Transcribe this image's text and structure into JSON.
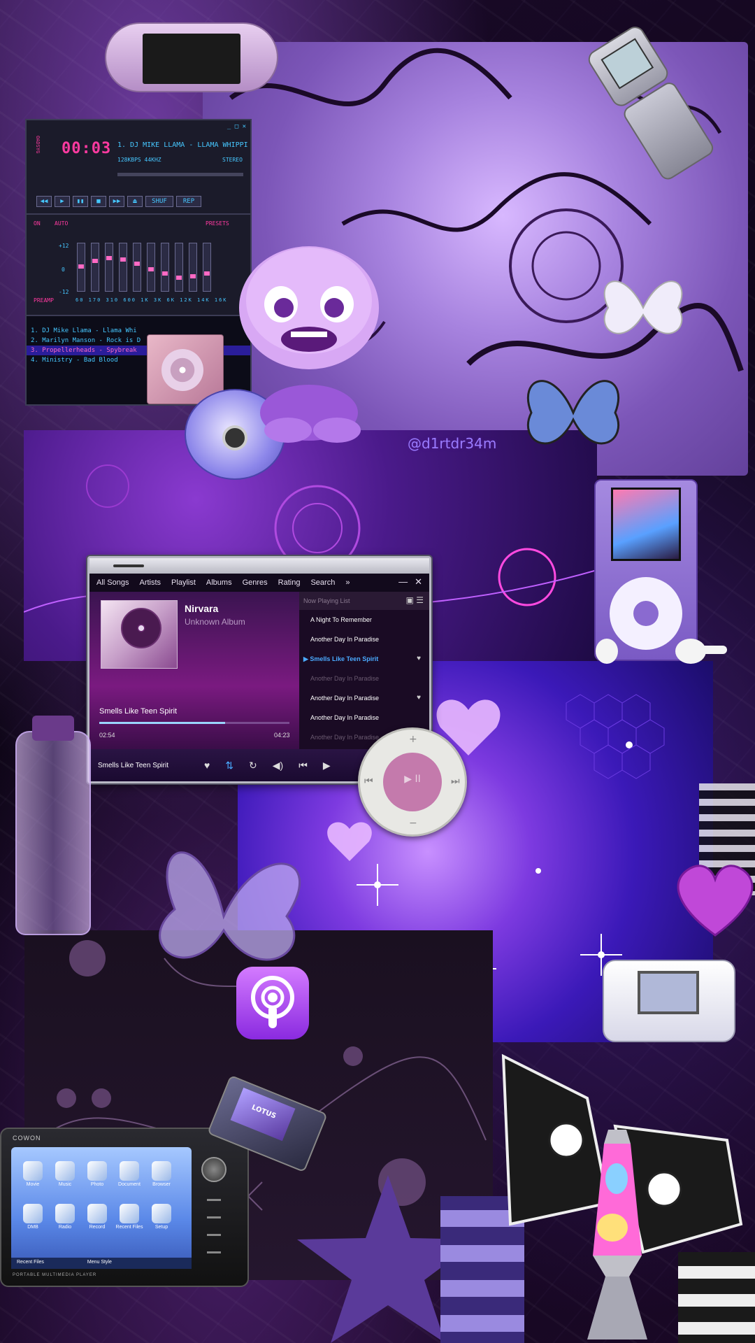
{
  "watermark": "@d1rtdr34m",
  "winamp": {
    "time": "00:03",
    "title": "1. DJ MIKE LLAMA - LLAMA WHIPPI",
    "bitrate": "128KBPS  44KHZ",
    "mode": "STEREO",
    "side_label": "OADSYG",
    "buttons": [
      "◀◀",
      "▶",
      "▮▮",
      "■",
      "▶▶",
      "⏏"
    ],
    "shuf": "SHUF",
    "rep": "REP",
    "eq_on": "ON",
    "eq_auto": "AUTO",
    "eq_presets": "PRESETS",
    "eq_preamp": "PREAMP",
    "eq_freqs": "60 170 310 600 1K 3K 6K 12K 14K 16K",
    "eq_levels": [
      "+12",
      "0",
      "-12"
    ],
    "playlist": [
      "1. DJ Mike Llama - Llama Whi",
      "2. Marilyn Manson - Rock is D",
      "3. Propellerheads - Spybreak",
      "4. Ministry - Bad Blood"
    ]
  },
  "media_player": {
    "nav": [
      "All Songs",
      "Artists",
      "Playlist",
      "Albums",
      "Genres",
      "Rating",
      "Search",
      "»"
    ],
    "minimize": "—",
    "close": "✕",
    "artist": "Nirvara",
    "album": "Unknown Album",
    "song": "Smells Like Teen Spirit",
    "elapsed": "02:54",
    "total": "04:23",
    "progress": 0.66,
    "list_header": "Now Playing List",
    "list": [
      {
        "title": "A Night To Remember",
        "style": "normal",
        "heart": ""
      },
      {
        "title": "Another Day In Paradise",
        "style": "normal",
        "heart": ""
      },
      {
        "title": "Smells Like Teen Spirit",
        "style": "cur",
        "heart": "♥"
      },
      {
        "title": "Another Day In Paradise",
        "style": "dim",
        "heart": ""
      },
      {
        "title": "Another Day In Paradise",
        "style": "normal",
        "heart": "♥"
      },
      {
        "title": "Another Day In Paradise",
        "style": "normal",
        "heart": ""
      },
      {
        "title": "Another Day In Paradise",
        "style": "dim",
        "heart": ""
      }
    ],
    "bottom_song": "Smells Like Teen Spirit",
    "controls": {
      "heart": "♥",
      "shuffle": "⇅",
      "repeat": "↻",
      "volume": "◀)",
      "prev": "⏮",
      "play": "▶"
    }
  },
  "shuffle": {
    "play_pause": "▶ II",
    "plus": "+",
    "minus": "−",
    "prev": "⏮",
    "next": "⏭"
  },
  "lg_phone": {
    "screen": "LOTUS"
  },
  "cowon": {
    "brand": "COWON",
    "subtitle": "PORTABLE MULTIMEDIA PLAYER",
    "apps": [
      "Movie",
      "Music",
      "Photo",
      "Document",
      "Browser",
      "DMB",
      "Radio",
      "Record",
      "Recent Files",
      "Setup"
    ],
    "footer_left": "Recent Files",
    "footer_right": "Menu Style"
  },
  "colors": {
    "accent": "#9a7cff",
    "winamp_text": "#46c7ff",
    "winamp_time": "#ff3aa0"
  }
}
